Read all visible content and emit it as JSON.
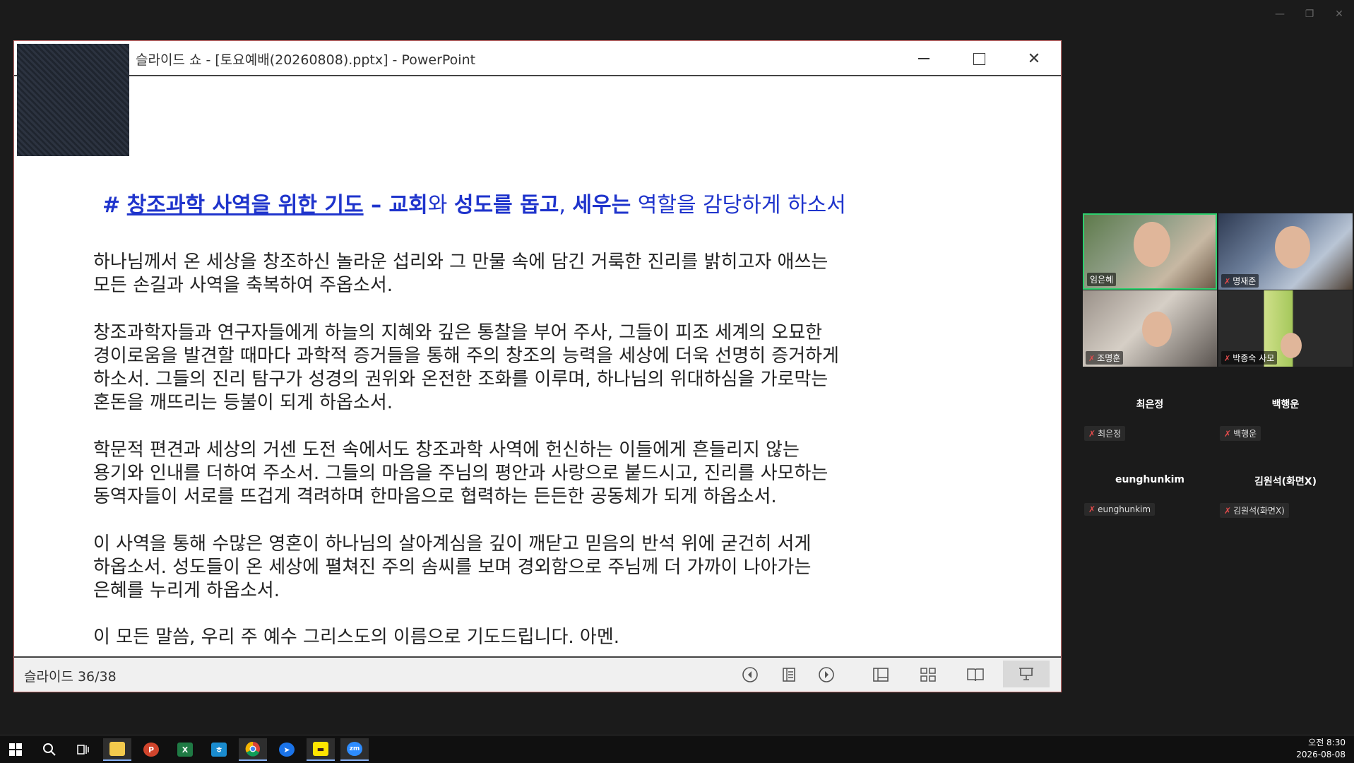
{
  "powerpoint": {
    "title": "슬라이드 쇼 - [토요예배(20260808).pptx] - PowerPoint",
    "slide_counter": "슬라이드 36/38"
  },
  "slide": {
    "heading": {
      "hash": "#",
      "underlined": "창조과학 사역을 위한 기도",
      "dash": " – ",
      "w1": "교회",
      "w2": "와 ",
      "w3": "성도를 돕고",
      "w4": ", ",
      "w5": "세우는",
      "w6": " 역할을 감당하게 하소서"
    },
    "paragraphs": [
      [
        "하나님께서 온 세상을 창조하신 놀라운 섭리와 그 만물 속에 담긴 거룩한 진리를 밝히고자 애쓰는",
        "모든 손길과 사역을 축복하여 주옵소서."
      ],
      [
        "창조과학자들과 연구자들에게 하늘의 지혜와 깊은 통찰을 부어 주사, 그들이 피조 세계의 오묘한",
        "경이로움을 발견할 때마다 과학적 증거들을 통해 주의 창조의 능력을 세상에 더욱 선명히 증거하게",
        "하소서. 그들의 진리 탐구가 성경의 권위와 온전한 조화를 이루며, 하나님의 위대하심을 가로막는",
        "혼돈을 깨뜨리는 등불이 되게 하옵소서."
      ],
      [
        "학문적 편견과 세상의 거센 도전 속에서도 창조과학 사역에 헌신하는 이들에게 흔들리지 않는",
        "용기와 인내를 더하여 주소서. 그들의 마음을 주님의 평안과 사랑으로 붙드시고, 진리를 사모하는",
        "동역자들이 서로를 뜨겁게 격려하며 한마음으로 협력하는 든든한 공동체가 되게 하옵소서."
      ],
      [
        "이 사역을 통해 수많은 영혼이 하나님의 살아계심을 깊이 깨닫고 믿음의 반석 위에 굳건히 서게",
        "하옵소서. 성도들이 온 세상에 펼쳐진 주의 솜씨를 보며 경외함으로 주님께 더 가까이 나아가는",
        "은혜를 누리게 하옵소서."
      ],
      [
        "이 모든 말씀, 우리 주 예수 그리스도의 이름으로 기도드립니다. 아멘."
      ]
    ]
  },
  "participants": {
    "video": [
      {
        "name": "임은혜",
        "muted": false
      },
      {
        "name": "명재준",
        "muted": true
      },
      {
        "name": "조명훈",
        "muted": true
      },
      {
        "name": "박종숙 사모",
        "muted": true
      }
    ],
    "audio_only": [
      {
        "name": "최은정",
        "tag": "최은정"
      },
      {
        "name": "백행운",
        "tag": "백행운"
      },
      {
        "name": "eunghunkim",
        "tag": "eunghunkim"
      },
      {
        "name": "김원석(화면X)",
        "tag": "김원석(화면X)"
      }
    ]
  },
  "taskbar": {
    "time": "오전 8:30",
    "date": "2026-08-08",
    "apps": [
      "windows-start",
      "search",
      "task-view",
      "file-explorer",
      "powerpoint",
      "excel",
      "hancom",
      "chrome",
      "app-arrow",
      "kakaotalk",
      "zoom"
    ]
  },
  "colors": {
    "heading_blue": "#1f34cc",
    "active_speaker": "#2ecf6e",
    "mic_muted": "#e34b4b"
  }
}
